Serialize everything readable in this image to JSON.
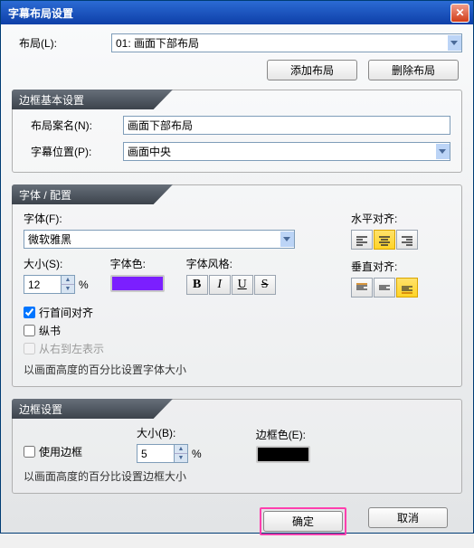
{
  "title": "字幕布局设置",
  "layout": {
    "label": "布局(L):",
    "value": "01: 画面下部布局",
    "add": "添加布局",
    "del": "删除布局"
  },
  "g_basic": {
    "head": "边框基本设置",
    "name_label": "布局案名(N):",
    "name_value": "画面下部布局",
    "pos_label": "字幕位置(P):",
    "pos_value": "画面中央"
  },
  "g_font": {
    "head": "字体 / 配置",
    "font_label": "字体(F):",
    "font_value": "微软雅黑",
    "size_label": "大小(S):",
    "size_value": "12",
    "pct": "%",
    "color_label": "字体色:",
    "style_label": "字体风格:",
    "halign_label": "水平对齐:",
    "valign_label": "垂直对齐:",
    "chk_linehead": "行首间对齐",
    "chk_tate": "纵书",
    "chk_rtl": "从右到左表示",
    "note": "以画面高度的百分比设置字体大小"
  },
  "g_border": {
    "head": "边框设置",
    "use_label": "使用边框",
    "size_label": "大小(B):",
    "size_value": "5",
    "pct": "%",
    "color_label": "边框色(E):",
    "note": "以画面高度的百分比设置边框大小"
  },
  "buttons": {
    "ok": "确定",
    "cancel": "取消"
  },
  "chart_data": null
}
